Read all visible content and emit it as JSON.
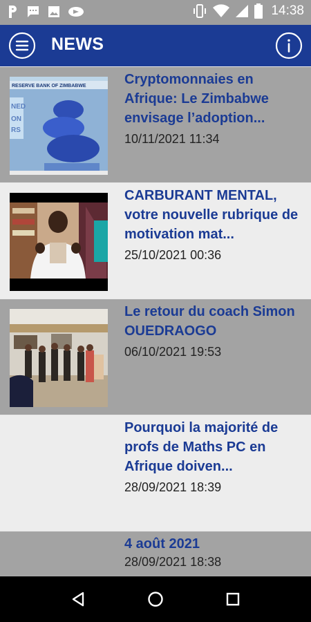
{
  "status_bar": {
    "time": "14:38",
    "left_icons": [
      "parking-icon",
      "message-icon",
      "image-icon",
      "cast-icon"
    ],
    "right_icons": [
      "vibrate-icon",
      "wifi-icon",
      "signal-icon",
      "battery-icon"
    ]
  },
  "app_bar": {
    "title": "NEWS",
    "menu_icon": "menu-icon",
    "info_icon": "info-icon",
    "color": "#1b3b94"
  },
  "articles": [
    {
      "title": "Cryptomonnaies en Afrique: Le Zimbabwe envisage l’adoption...",
      "date": "10/11/2021 11:34",
      "has_image": true,
      "image_text": "RESERVE BANK OF ZIMBABWE"
    },
    {
      "title": "CARBURANT MENTAL, votre nouvelle rubrique de motivation mat...",
      "date": "25/10/2021 00:36",
      "has_image": true
    },
    {
      "title": "Le retour du coach Simon OUEDRAOGO",
      "date": "06/10/2021 19:53",
      "has_image": true
    },
    {
      "title": "Pourquoi la majorité de profs de Maths PC en Afrique doiven...",
      "date": "28/09/2021 18:39",
      "has_image": false
    },
    {
      "title": "4 août 2021",
      "date": "28/09/2021 18:38",
      "has_image": false
    }
  ],
  "nav_bar": {
    "buttons": [
      "back-icon",
      "home-icon",
      "recents-icon"
    ]
  }
}
